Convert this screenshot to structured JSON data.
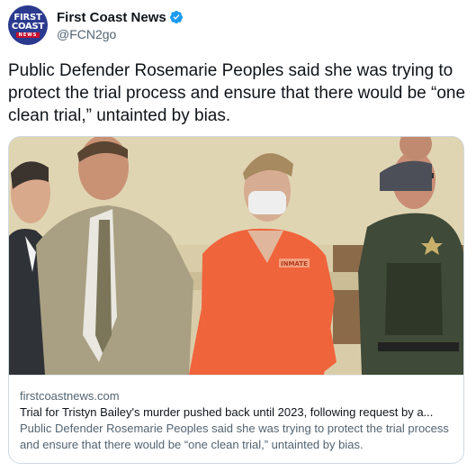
{
  "account": {
    "display_name": "First Coast News",
    "handle": "@FCN2go",
    "avatar_lines": [
      "FIRST",
      "COAST",
      "NEWS"
    ]
  },
  "tweet": {
    "text": "Public Defender Rosemarie Peoples said she was trying to protect the trial process and ensure that there would be “one clean trial,” untainted by bias."
  },
  "card": {
    "domain": "firstcoastnews.com",
    "title": "Trial for Tristyn Bailey's murder pushed back until 2023, following request by a...",
    "description": "Public Defender Rosemarie Peoples said she was trying to protect the trial process and ensure that there would be “one clean trial,” untainted by bias.",
    "image_shirt_text": "INMATE"
  },
  "colors": {
    "verified_badge": "#1d9bf0",
    "avatar_bg": "#2b3a8f",
    "secondary_text": "#536471"
  },
  "icons": [
    "verified-badge-icon"
  ]
}
